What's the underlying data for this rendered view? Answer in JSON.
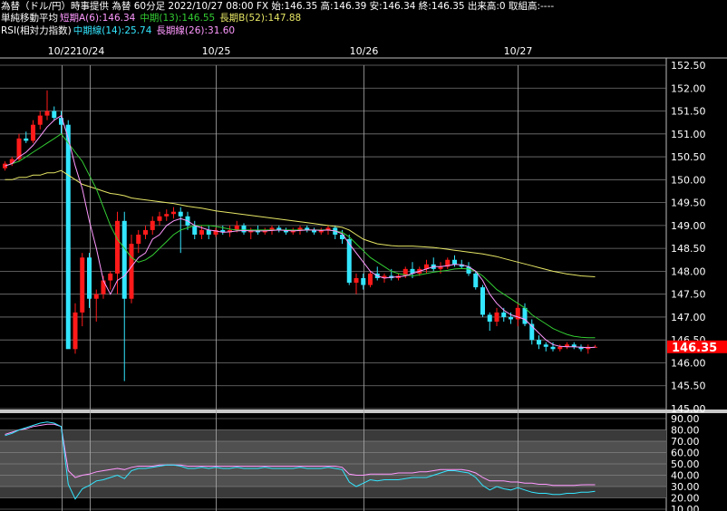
{
  "header": {
    "line1": "為替（ドル/円）時事提供 為替 60分足 2022/10/27 08:00 FX 始:146.35 高:146.39 安:146.34 終:146.35 出来高:0 取組高:----",
    "ma_title": "単純移動平均",
    "ma_short": "短期A(6):146.34",
    "ma_mid": "中期(13):146.55",
    "ma_long": "長期B(52):147.88",
    "rsi_title": "RSI(相対力指数)",
    "rsi_mid": "中期線(14):25.74",
    "rsi_long": "長期線(26):31.60"
  },
  "colors": {
    "up": "#ff1a1a",
    "down": "#33e6ff",
    "ma_short": "#ff99ff",
    "ma_mid": "#33cc33",
    "ma_long": "#e6e666",
    "rsi_mid": "#33e6ff",
    "rsi_long": "#ff99ff",
    "last_price_bg": "#ff0000"
  },
  "chart_data": [
    {
      "type": "candlestick",
      "x_labels": [
        "10/22",
        "10/24",
        "10/25",
        "10/26",
        "10/27"
      ],
      "y_ticks": [
        "152.50",
        "152.00",
        "151.50",
        "151.00",
        "150.50",
        "150.00",
        "149.50",
        "149.00",
        "148.50",
        "148.00",
        "147.50",
        "147.00",
        "146.50",
        "146.00",
        "145.50",
        "145.00"
      ],
      "ylim": [
        145.0,
        152.5
      ],
      "last_price": "146.35",
      "ohlc": [
        [
          150.25,
          150.4,
          150.2,
          150.35
        ],
        [
          150.35,
          150.5,
          150.3,
          150.45
        ],
        [
          150.45,
          151.0,
          150.4,
          150.9
        ],
        [
          150.9,
          151.05,
          150.8,
          150.85
        ],
        [
          150.85,
          151.3,
          150.8,
          151.2
        ],
        [
          151.2,
          151.5,
          151.1,
          151.4
        ],
        [
          151.4,
          151.95,
          151.3,
          151.5
        ],
        [
          151.5,
          151.6,
          151.3,
          151.35
        ],
        [
          151.35,
          151.5,
          151.0,
          151.2
        ],
        [
          151.2,
          151.3,
          146.4,
          146.3
        ],
        [
          146.3,
          147.3,
          146.2,
          147.1
        ],
        [
          147.1,
          148.4,
          146.8,
          148.3
        ],
        [
          148.3,
          148.4,
          147.2,
          147.4
        ],
        [
          147.4,
          147.6,
          146.9,
          147.5
        ],
        [
          147.5,
          147.9,
          147.4,
          147.8
        ],
        [
          147.8,
          148.0,
          147.6,
          147.95
        ],
        [
          147.95,
          149.3,
          147.5,
          149.1
        ],
        [
          149.1,
          149.3,
          145.6,
          147.4
        ],
        [
          147.4,
          148.8,
          147.3,
          148.6
        ],
        [
          148.6,
          148.9,
          148.4,
          148.8
        ],
        [
          148.8,
          149.0,
          148.7,
          148.9
        ],
        [
          148.9,
          149.2,
          148.8,
          149.1
        ],
        [
          149.1,
          149.3,
          149.0,
          149.2
        ],
        [
          149.2,
          149.35,
          149.1,
          149.25
        ],
        [
          149.25,
          149.4,
          149.15,
          149.3
        ],
        [
          149.3,
          149.4,
          148.4,
          149.2
        ],
        [
          149.2,
          149.3,
          148.9,
          149.0
        ],
        [
          149.0,
          149.1,
          148.7,
          148.8
        ],
        [
          148.8,
          149.0,
          148.7,
          148.9
        ],
        [
          148.9,
          149.0,
          148.7,
          148.8
        ],
        [
          148.8,
          148.95,
          148.75,
          148.9
        ],
        [
          148.9,
          149.0,
          148.8,
          148.85
        ],
        [
          148.85,
          149.0,
          148.75,
          148.9
        ],
        [
          148.9,
          149.1,
          148.85,
          149.0
        ],
        [
          149.0,
          149.05,
          148.8,
          148.85
        ],
        [
          148.85,
          148.95,
          148.7,
          148.9
        ],
        [
          148.9,
          149.0,
          148.8,
          148.85
        ],
        [
          148.85,
          148.95,
          148.8,
          148.9
        ],
        [
          148.9,
          149.0,
          148.8,
          148.95
        ],
        [
          148.95,
          149.0,
          148.85,
          148.9
        ],
        [
          148.9,
          148.95,
          148.8,
          148.85
        ],
        [
          148.85,
          148.95,
          148.8,
          148.9
        ],
        [
          148.9,
          149.0,
          148.8,
          148.95
        ],
        [
          148.95,
          149.0,
          148.85,
          148.9
        ],
        [
          148.9,
          148.95,
          148.8,
          148.85
        ],
        [
          148.85,
          148.95,
          148.8,
          148.9
        ],
        [
          148.9,
          149.0,
          148.8,
          148.95
        ],
        [
          148.95,
          149.0,
          148.7,
          148.8
        ],
        [
          148.8,
          148.9,
          148.6,
          148.7
        ],
        [
          148.7,
          148.8,
          147.7,
          147.75
        ],
        [
          147.75,
          147.95,
          147.5,
          147.85
        ],
        [
          147.85,
          147.95,
          147.6,
          147.7
        ],
        [
          147.7,
          148.0,
          147.65,
          147.95
        ],
        [
          147.95,
          148.1,
          147.8,
          147.85
        ],
        [
          147.85,
          147.95,
          147.75,
          147.9
        ],
        [
          147.9,
          148.05,
          147.8,
          147.85
        ],
        [
          147.85,
          147.95,
          147.8,
          147.9
        ],
        [
          147.9,
          148.1,
          147.85,
          148.05
        ],
        [
          148.05,
          148.2,
          147.85,
          147.95
        ],
        [
          147.95,
          148.1,
          147.9,
          148.05
        ],
        [
          148.05,
          148.25,
          147.95,
          148.15
        ],
        [
          148.15,
          148.3,
          148.0,
          148.05
        ],
        [
          148.05,
          148.2,
          147.95,
          148.1
        ],
        [
          148.1,
          148.3,
          148.05,
          148.25
        ],
        [
          148.25,
          148.35,
          148.1,
          148.15
        ],
        [
          148.15,
          148.25,
          148.05,
          148.1
        ],
        [
          148.1,
          148.2,
          147.9,
          147.95
        ],
        [
          147.95,
          148.0,
          147.6,
          147.65
        ],
        [
          147.65,
          147.7,
          147.0,
          147.05
        ],
        [
          147.05,
          147.1,
          146.7,
          146.9
        ],
        [
          146.9,
          147.2,
          146.8,
          147.1
        ],
        [
          147.1,
          147.2,
          146.9,
          147.0
        ],
        [
          147.0,
          147.1,
          146.85,
          146.95
        ],
        [
          146.95,
          147.3,
          146.8,
          147.2
        ],
        [
          147.2,
          147.3,
          146.8,
          146.85
        ],
        [
          146.85,
          146.95,
          146.4,
          146.5
        ],
        [
          146.5,
          146.6,
          146.3,
          146.4
        ],
        [
          146.4,
          146.45,
          146.25,
          146.35
        ],
        [
          146.35,
          146.45,
          146.25,
          146.3
        ],
        [
          146.3,
          146.4,
          146.25,
          146.35
        ],
        [
          146.35,
          146.45,
          146.3,
          146.4
        ],
        [
          146.4,
          146.45,
          146.3,
          146.35
        ],
        [
          146.35,
          146.4,
          146.25,
          146.3
        ],
        [
          146.3,
          146.4,
          146.2,
          146.35
        ],
        [
          146.35,
          146.39,
          146.34,
          146.35
        ]
      ],
      "ma_short": [
        150.3,
        150.35,
        150.5,
        150.6,
        150.75,
        150.95,
        151.15,
        151.3,
        151.4,
        150.9,
        150.3,
        149.8,
        149.1,
        148.5,
        147.8,
        147.5,
        147.8,
        147.9,
        148.1,
        148.3,
        148.4,
        148.7,
        148.8,
        149.0,
        149.1,
        149.15,
        149.1,
        149.0,
        148.95,
        148.9,
        148.88,
        148.85,
        148.86,
        148.88,
        148.89,
        148.88,
        148.88,
        148.88,
        148.89,
        148.9,
        148.89,
        148.88,
        148.89,
        148.9,
        148.9,
        148.89,
        148.9,
        148.88,
        148.82,
        148.6,
        148.4,
        148.2,
        148.0,
        147.9,
        147.85,
        147.87,
        147.88,
        147.9,
        147.95,
        148.0,
        148.05,
        148.1,
        148.1,
        148.12,
        148.15,
        148.14,
        148.1,
        148.0,
        147.8,
        147.5,
        147.3,
        147.15,
        147.05,
        147.0,
        146.95,
        146.8,
        146.65,
        146.5,
        146.4,
        146.36,
        146.35,
        146.35,
        146.34,
        146.33,
        146.34
      ],
      "ma_mid": [
        150.3,
        150.35,
        150.4,
        150.5,
        150.6,
        150.7,
        150.8,
        150.9,
        151.0,
        150.8,
        150.6,
        150.4,
        150.1,
        149.8,
        149.4,
        149.0,
        148.7,
        148.5,
        148.3,
        148.2,
        148.25,
        148.35,
        148.5,
        148.65,
        148.8,
        148.9,
        148.95,
        149.0,
        149.0,
        149.0,
        148.98,
        148.95,
        148.92,
        148.9,
        148.9,
        148.9,
        148.9,
        148.9,
        148.9,
        148.9,
        148.9,
        148.9,
        148.9,
        148.9,
        148.9,
        148.9,
        148.9,
        148.88,
        148.85,
        148.75,
        148.6,
        148.45,
        148.3,
        148.2,
        148.1,
        148.0,
        147.95,
        147.92,
        147.9,
        147.92,
        147.95,
        147.98,
        148.0,
        148.02,
        148.05,
        148.06,
        148.05,
        148.0,
        147.9,
        147.75,
        147.6,
        147.5,
        147.4,
        147.3,
        147.2,
        147.05,
        146.95,
        146.85,
        146.75,
        146.68,
        146.62,
        146.58,
        146.56,
        146.55,
        146.55
      ],
      "ma_long": [
        150.0,
        150.0,
        150.05,
        150.05,
        150.1,
        150.1,
        150.15,
        150.15,
        150.2,
        150.1,
        150.0,
        149.9,
        149.85,
        149.8,
        149.75,
        149.7,
        149.68,
        149.65,
        149.6,
        149.58,
        149.56,
        149.54,
        149.52,
        149.5,
        149.48,
        149.45,
        149.42,
        149.4,
        149.38,
        149.35,
        149.32,
        149.3,
        149.28,
        149.26,
        149.24,
        149.22,
        149.2,
        149.18,
        149.16,
        149.14,
        149.12,
        149.1,
        149.08,
        149.06,
        149.04,
        149.02,
        149.0,
        148.98,
        148.96,
        148.9,
        148.8,
        148.7,
        148.65,
        148.6,
        148.58,
        148.56,
        148.55,
        148.55,
        148.55,
        148.54,
        148.53,
        148.52,
        148.5,
        148.48,
        148.46,
        148.44,
        148.42,
        148.4,
        148.38,
        148.35,
        148.32,
        148.28,
        148.24,
        148.2,
        148.16,
        148.12,
        148.08,
        148.04,
        148.0,
        147.97,
        147.94,
        147.92,
        147.9,
        147.89,
        147.88
      ]
    },
    {
      "type": "line",
      "name": "RSI",
      "y_ticks": [
        "90.00",
        "80.00",
        "70.00",
        "60.00",
        "50.00",
        "40.00",
        "30.00",
        "20.00",
        "10.00"
      ],
      "ylim": [
        10,
        90
      ],
      "bands": [
        [
          70,
          80,
          "#3a3a3a"
        ],
        [
          30,
          70,
          "#505050"
        ],
        [
          20,
          30,
          "#3a3a3a"
        ]
      ],
      "rsi_mid": [
        75,
        77,
        80,
        82,
        84,
        86,
        87,
        86,
        83,
        32,
        19,
        28,
        31,
        35,
        36,
        38,
        40,
        37,
        44,
        46,
        46,
        47,
        48,
        49,
        49,
        48,
        46,
        46,
        47,
        46,
        47,
        46,
        46,
        47,
        46,
        46,
        46,
        47,
        46,
        46,
        46,
        46,
        47,
        46,
        46,
        46,
        47,
        46,
        45,
        34,
        30,
        33,
        36,
        35,
        36,
        36,
        36,
        37,
        38,
        38,
        38,
        40,
        42,
        44,
        44,
        43,
        42,
        38,
        31,
        27,
        30,
        28,
        27,
        29,
        27,
        25,
        24,
        24,
        23,
        23,
        24,
        24,
        25,
        25,
        25.74
      ],
      "rsi_long": [
        76,
        78,
        80,
        81,
        83,
        84,
        85,
        85,
        83,
        44,
        38,
        40,
        41,
        43,
        44,
        45,
        46,
        45,
        47,
        48,
        48,
        48,
        49,
        49,
        49,
        49,
        48,
        48,
        48,
        48,
        48,
        48,
        48,
        48,
        48,
        48,
        48,
        48,
        48,
        48,
        48,
        48,
        48,
        48,
        48,
        48,
        48,
        48,
        47,
        41,
        40,
        40,
        41,
        41,
        41,
        41,
        42,
        42,
        42,
        43,
        43,
        44,
        45,
        45,
        45,
        45,
        44,
        42,
        38,
        35,
        35,
        35,
        34,
        34,
        33,
        33,
        32,
        32,
        31,
        31,
        31,
        31,
        31.5,
        31.6,
        31.6
      ]
    }
  ]
}
